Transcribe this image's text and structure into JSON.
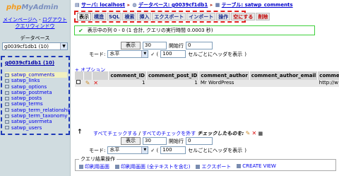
{
  "nav": {
    "logo_part1": "php",
    "logo_part2": "MyAdmin",
    "link_home": "メインページへ",
    "link_logout": "ログアウト",
    "link_query": "クエリウィンドウ",
    "db_label": "データベース",
    "db_selected": "g0039cf1db1 (10)",
    "db_heading": "g0039cf1db1 (10)",
    "tables": [
      "satwp_comments",
      "satwp_links",
      "satwp_options",
      "satwp_postmeta",
      "satwp_posts",
      "satwp_terms",
      "satwp_term_relationships",
      "satwp_term_taxonomy",
      "satwp_usermeta",
      "satwp_users"
    ]
  },
  "breadcrumb": {
    "server": "サーバ: localhost",
    "database": "データベース: g0039cf1db1",
    "table": "テーブル: satwp_comments"
  },
  "tabs": [
    "表示",
    "構造",
    "SQL",
    "検索",
    "挿入",
    "エクスポート",
    "インポート",
    "操作",
    "空にする",
    "削除"
  ],
  "message": "表示中の列 0 - 0 (1 合計, クエリの実行時間 0.0003 秒)",
  "nav_controls": {
    "show_button": "表示",
    "rows_value": "30",
    "start_label": "開始行",
    "start_value": "0",
    "mode_label": "モード:",
    "mode_value": "水平",
    "repeat_text": "セルごとにヘッダを表示",
    "repeat_value": "100"
  },
  "options_link": "+ オプション",
  "table": {
    "headers": [
      "comment_ID",
      "comment_post_ID",
      "comment_author",
      "comment_author_email",
      "commei"
    ],
    "rows": [
      [
        "1",
        "1",
        "Mr WordPress",
        "",
        "http://w"
      ]
    ]
  },
  "check_all": {
    "check_all_label": "すべてチェックする",
    "uncheck_all_label": "すべてのチェックを外す",
    "with_selected": "チェックしたものを:"
  },
  "query_ops": {
    "legend": "クエリ結果操作",
    "print_view": "印刷用画面",
    "print_view_full": "印刷用画面 (全テキストを含む)",
    "export": "エクスポート",
    "create_view": "CREATE VIEW"
  }
}
